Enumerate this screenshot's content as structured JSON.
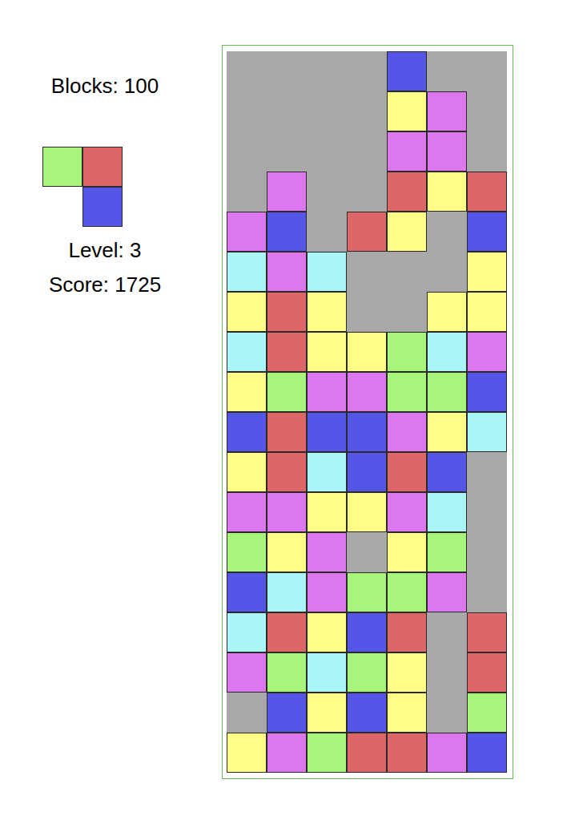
{
  "stats": {
    "blocks": "Blocks: 100",
    "level": "Level: 3",
    "score": "Score: 1725"
  },
  "next_piece": {
    "cells": [
      {
        "filled": true,
        "color": "#a8f57c"
      },
      {
        "filled": true,
        "color": "#dd6666"
      },
      {
        "filled": false
      },
      {
        "filled": true,
        "color": "#5555e8"
      }
    ]
  },
  "board": {
    "rows": [
      [
        {
          "filled": false
        },
        {
          "filled": false
        },
        {
          "filled": false
        },
        {
          "filled": false
        },
        {
          "filled": true,
          "color": "#5555e8"
        },
        {
          "filled": false
        },
        {
          "filled": false
        }
      ],
      [
        {
          "filled": false
        },
        {
          "filled": false
        },
        {
          "filled": false
        },
        {
          "filled": false
        },
        {
          "filled": true,
          "color": "#ffff88"
        },
        {
          "filled": true,
          "color": "#dd77ee"
        },
        {
          "filled": false
        }
      ],
      [
        {
          "filled": false
        },
        {
          "filled": false
        },
        {
          "filled": false
        },
        {
          "filled": false
        },
        {
          "filled": true,
          "color": "#dd77ee"
        },
        {
          "filled": true,
          "color": "#dd77ee"
        },
        {
          "filled": false
        }
      ],
      [
        {
          "filled": false
        },
        {
          "filled": true,
          "color": "#dd77ee"
        },
        {
          "filled": false
        },
        {
          "filled": false
        },
        {
          "filled": true,
          "color": "#dd6666"
        },
        {
          "filled": true,
          "color": "#ffff88"
        },
        {
          "filled": true,
          "color": "#dd6666"
        }
      ],
      [
        {
          "filled": true,
          "color": "#dd77ee"
        },
        {
          "filled": true,
          "color": "#5555e8"
        },
        {
          "filled": false
        },
        {
          "filled": true,
          "color": "#dd6666"
        },
        {
          "filled": true,
          "color": "#ffff88"
        },
        {
          "filled": false
        },
        {
          "filled": true,
          "color": "#5555e8"
        }
      ],
      [
        {
          "filled": true,
          "color": "#aaf5f8"
        },
        {
          "filled": true,
          "color": "#dd77ee"
        },
        {
          "filled": true,
          "color": "#aaf5f8"
        },
        {
          "filled": false
        },
        {
          "filled": false
        },
        {
          "filled": false
        },
        {
          "filled": true,
          "color": "#ffff88"
        }
      ],
      [
        {
          "filled": true,
          "color": "#ffff88"
        },
        {
          "filled": true,
          "color": "#dd6666"
        },
        {
          "filled": true,
          "color": "#ffff88"
        },
        {
          "filled": false
        },
        {
          "filled": false
        },
        {
          "filled": true,
          "color": "#ffff88"
        },
        {
          "filled": true,
          "color": "#ffff88"
        }
      ],
      [
        {
          "filled": true,
          "color": "#aaf5f8"
        },
        {
          "filled": true,
          "color": "#dd6666"
        },
        {
          "filled": true,
          "color": "#ffff88"
        },
        {
          "filled": true,
          "color": "#ffff88"
        },
        {
          "filled": true,
          "color": "#a8f57c"
        },
        {
          "filled": true,
          "color": "#aaf5f8"
        },
        {
          "filled": true,
          "color": "#dd77ee"
        }
      ],
      [
        {
          "filled": true,
          "color": "#ffff88"
        },
        {
          "filled": true,
          "color": "#a8f57c"
        },
        {
          "filled": true,
          "color": "#dd77ee"
        },
        {
          "filled": true,
          "color": "#dd77ee"
        },
        {
          "filled": true,
          "color": "#a8f57c"
        },
        {
          "filled": true,
          "color": "#a8f57c"
        },
        {
          "filled": true,
          "color": "#5555e8"
        }
      ],
      [
        {
          "filled": true,
          "color": "#5555e8"
        },
        {
          "filled": true,
          "color": "#dd6666"
        },
        {
          "filled": true,
          "color": "#5555e8"
        },
        {
          "filled": true,
          "color": "#5555e8"
        },
        {
          "filled": true,
          "color": "#dd77ee"
        },
        {
          "filled": true,
          "color": "#ffff88"
        },
        {
          "filled": true,
          "color": "#aaf5f8"
        }
      ],
      [
        {
          "filled": true,
          "color": "#ffff88"
        },
        {
          "filled": true,
          "color": "#dd6666"
        },
        {
          "filled": true,
          "color": "#aaf5f8"
        },
        {
          "filled": true,
          "color": "#5555e8"
        },
        {
          "filled": true,
          "color": "#dd6666"
        },
        {
          "filled": true,
          "color": "#5555e8"
        },
        {
          "filled": false
        }
      ],
      [
        {
          "filled": true,
          "color": "#dd77ee"
        },
        {
          "filled": true,
          "color": "#dd77ee"
        },
        {
          "filled": true,
          "color": "#ffff88"
        },
        {
          "filled": true,
          "color": "#ffff88"
        },
        {
          "filled": true,
          "color": "#dd77ee"
        },
        {
          "filled": true,
          "color": "#aaf5f8"
        },
        {
          "filled": false
        }
      ],
      [
        {
          "filled": true,
          "color": "#a8f57c"
        },
        {
          "filled": true,
          "color": "#ffff88"
        },
        {
          "filled": true,
          "color": "#dd77ee"
        },
        {
          "filled": false
        },
        {
          "filled": true,
          "color": "#ffff88"
        },
        {
          "filled": true,
          "color": "#a8f57c"
        },
        {
          "filled": false
        }
      ],
      [
        {
          "filled": true,
          "color": "#5555e8"
        },
        {
          "filled": true,
          "color": "#aaf5f8"
        },
        {
          "filled": true,
          "color": "#dd77ee"
        },
        {
          "filled": true,
          "color": "#a8f57c"
        },
        {
          "filled": true,
          "color": "#a8f57c"
        },
        {
          "filled": true,
          "color": "#dd77ee"
        },
        {
          "filled": false
        }
      ],
      [
        {
          "filled": true,
          "color": "#aaf5f8"
        },
        {
          "filled": true,
          "color": "#dd6666"
        },
        {
          "filled": true,
          "color": "#ffff88"
        },
        {
          "filled": true,
          "color": "#5555e8"
        },
        {
          "filled": true,
          "color": "#dd6666"
        },
        {
          "filled": false
        },
        {
          "filled": true,
          "color": "#dd6666"
        }
      ],
      [
        {
          "filled": true,
          "color": "#dd77ee"
        },
        {
          "filled": true,
          "color": "#a8f57c"
        },
        {
          "filled": true,
          "color": "#aaf5f8"
        },
        {
          "filled": true,
          "color": "#a8f57c"
        },
        {
          "filled": true,
          "color": "#ffff88"
        },
        {
          "filled": false
        },
        {
          "filled": true,
          "color": "#dd6666"
        }
      ],
      [
        {
          "filled": false
        },
        {
          "filled": true,
          "color": "#5555e8"
        },
        {
          "filled": true,
          "color": "#ffff88"
        },
        {
          "filled": true,
          "color": "#5555e8"
        },
        {
          "filled": true,
          "color": "#ffff88"
        },
        {
          "filled": false
        },
        {
          "filled": true,
          "color": "#a8f57c"
        }
      ],
      [
        {
          "filled": true,
          "color": "#ffff88"
        },
        {
          "filled": true,
          "color": "#dd77ee"
        },
        {
          "filled": true,
          "color": "#a8f57c"
        },
        {
          "filled": true,
          "color": "#dd6666"
        },
        {
          "filled": true,
          "color": "#dd6666"
        },
        {
          "filled": true,
          "color": "#dd77ee"
        },
        {
          "filled": true,
          "color": "#5555e8"
        }
      ]
    ]
  }
}
